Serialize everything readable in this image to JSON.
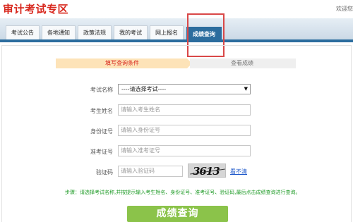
{
  "header": {
    "site_title": "审计考试专区",
    "welcome_text": "欢迎您"
  },
  "nav": {
    "tabs": [
      {
        "label": "考试公告"
      },
      {
        "label": "各地通知"
      },
      {
        "label": "政策法规"
      },
      {
        "label": "我的考试"
      },
      {
        "label": "网上报名"
      },
      {
        "label": "成绩查询",
        "active": true
      }
    ]
  },
  "steps": {
    "step1": "填写查询条件",
    "step2": "查看成绩"
  },
  "form": {
    "exam_name_label": "考试名称",
    "exam_name_value": "----请选择考试----",
    "candidate_name_label": "考生姓名",
    "candidate_name_placeholder": "请输入考生姓名",
    "id_number_label": "身份证号",
    "id_number_placeholder": "请输入身份证号",
    "admission_label": "准考证号",
    "admission_placeholder": "请输入准考证号",
    "captcha_label": "验证码",
    "captcha_placeholder": "请输入验证码",
    "captcha_image_text": "3613",
    "refresh_label": "看不清"
  },
  "hint_text": "步骤：请选择考试名称,并按提示输入考生姓名、身份证号、准考证号、验证码,最后点击成绩查询进行查询。",
  "submit_label": "成绩查询",
  "colors": {
    "title_red": "#d8281e",
    "nav_blue": "#2c6d9e",
    "highlight_red": "#d94848",
    "hint_green": "#1c9a24",
    "button_green": "#8bc34a"
  }
}
